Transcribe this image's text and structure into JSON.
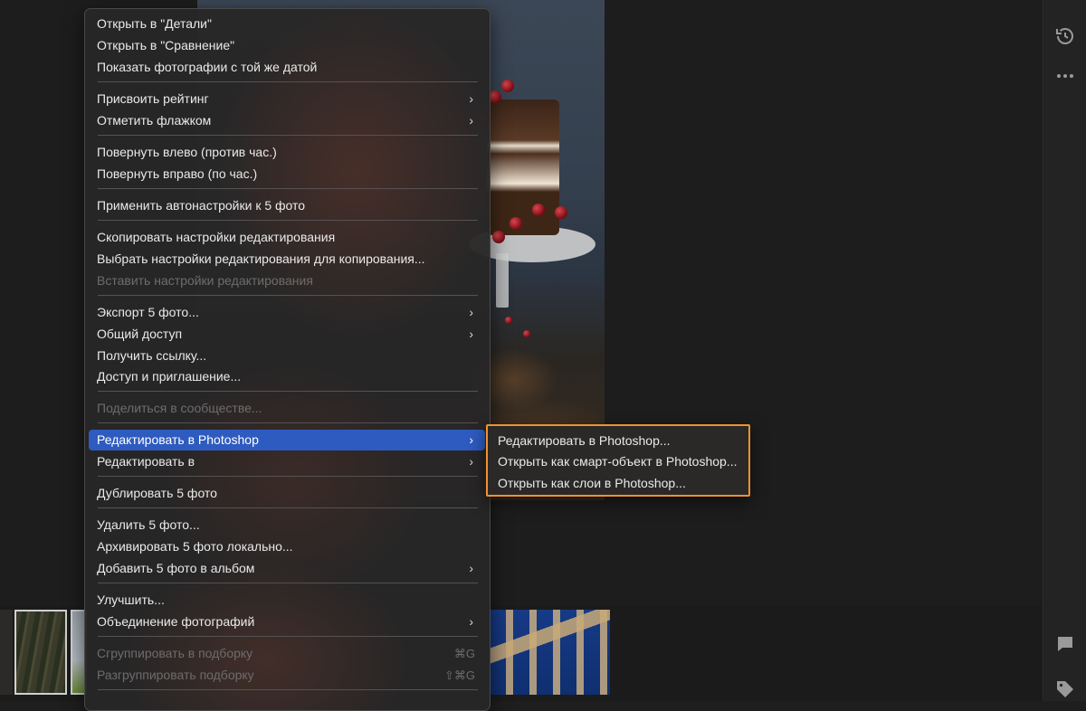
{
  "menu": {
    "items": [
      {
        "label": "Открыть в \"Детали\"",
        "submenu": false,
        "disabled": false
      },
      {
        "label": "Открыть в \"Сравнение\"",
        "submenu": false,
        "disabled": false
      },
      {
        "label": "Показать фотографии с той же датой",
        "submenu": false,
        "disabled": false
      },
      {
        "label": "Присвоить рейтинг",
        "submenu": true,
        "disabled": false
      },
      {
        "label": "Отметить флажком",
        "submenu": true,
        "disabled": false
      },
      {
        "label": "Повернуть влево (против час.)",
        "submenu": false,
        "disabled": false
      },
      {
        "label": "Повернуть вправо (по час.)",
        "submenu": false,
        "disabled": false
      },
      {
        "label": "Применить автонастройки к 5 фото",
        "submenu": false,
        "disabled": false
      },
      {
        "label": "Скопировать настройки редактирования",
        "submenu": false,
        "disabled": false
      },
      {
        "label": "Выбрать настройки редактирования для копирования...",
        "submenu": false,
        "disabled": false
      },
      {
        "label": "Вставить настройки редактирования",
        "submenu": false,
        "disabled": true
      },
      {
        "label": "Экспорт 5 фото...",
        "submenu": true,
        "disabled": false
      },
      {
        "label": "Общий доступ",
        "submenu": true,
        "disabled": false
      },
      {
        "label": "Получить ссылку...",
        "submenu": false,
        "disabled": false
      },
      {
        "label": "Доступ и приглашение...",
        "submenu": false,
        "disabled": false
      },
      {
        "label": "Поделиться в сообществе...",
        "submenu": false,
        "disabled": true
      },
      {
        "label": "Редактировать в Photoshop",
        "submenu": true,
        "disabled": false,
        "selected": true
      },
      {
        "label": "Редактировать в",
        "submenu": true,
        "disabled": false
      },
      {
        "label": "Дублировать 5 фото",
        "submenu": false,
        "disabled": false
      },
      {
        "label": "Удалить 5 фото...",
        "submenu": false,
        "disabled": false
      },
      {
        "label": "Архивировать 5 фото локально...",
        "submenu": false,
        "disabled": false
      },
      {
        "label": "Добавить 5 фото в альбом",
        "submenu": true,
        "disabled": false
      },
      {
        "label": "Улучшить...",
        "submenu": false,
        "disabled": false
      },
      {
        "label": "Объединение фотографий",
        "submenu": true,
        "disabled": false
      },
      {
        "label": "Сгруппировать в подборку",
        "submenu": false,
        "disabled": true,
        "shortcut": "⌘G"
      },
      {
        "label": "Разгруппировать подборку",
        "submenu": false,
        "disabled": true,
        "shortcut": "⇧⌘G"
      }
    ]
  },
  "submenu": {
    "items": [
      {
        "label": "Редактировать в Photoshop..."
      },
      {
        "label": "Открыть как смарт-объект в Photoshop..."
      },
      {
        "label": "Открыть как слои в Photoshop..."
      }
    ]
  },
  "icons": {
    "chevron": "›",
    "history": "history-icon",
    "more": "more-icon",
    "comment": "comment-icon",
    "tag": "tag-icon"
  },
  "colors": {
    "selection": "#2e5bbf",
    "highlight_border": "#f0922f"
  }
}
